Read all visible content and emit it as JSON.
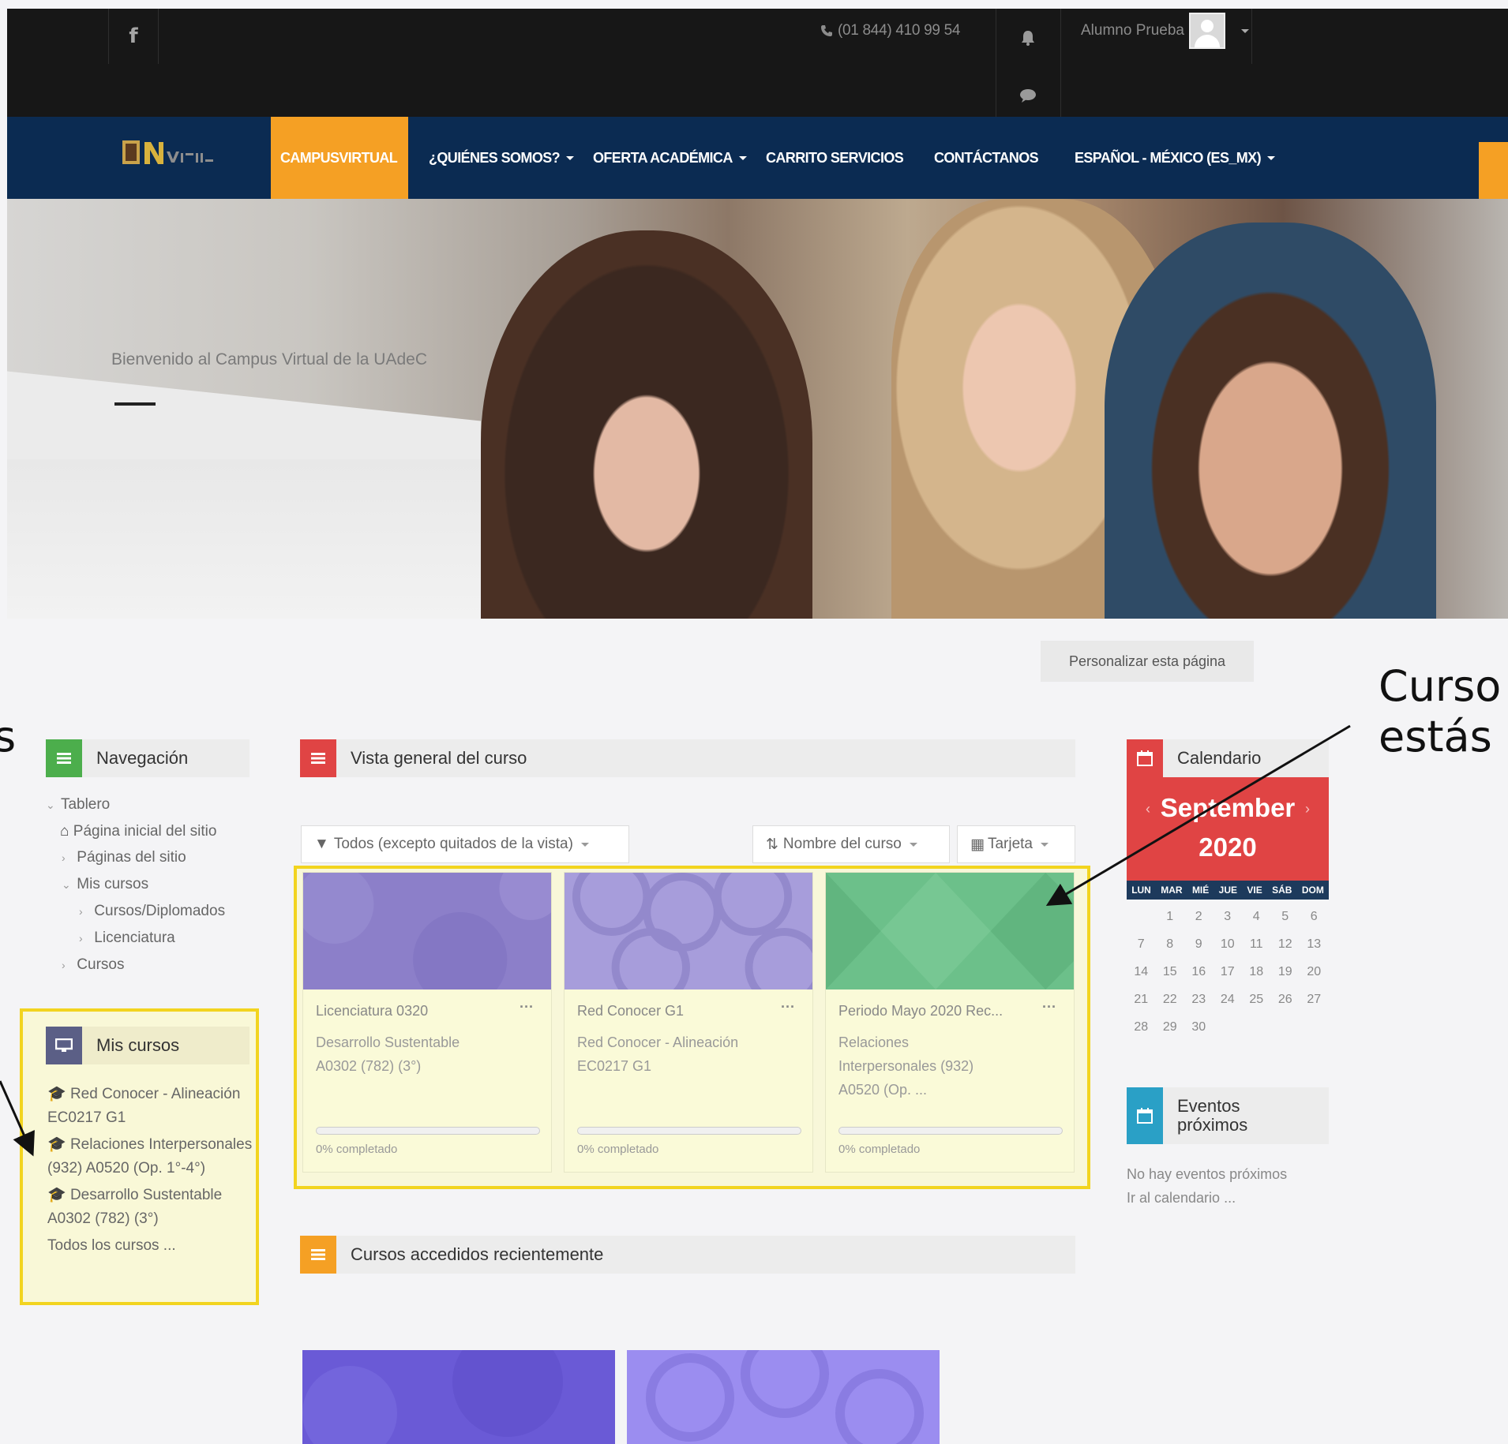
{
  "topbar": {
    "facebook_icon": "f",
    "phone": "(01 844) 410 99 54",
    "user_name": "Alumno Prueba"
  },
  "nav": {
    "items": [
      {
        "label": "CAMPUSVIRTUAL"
      },
      {
        "label": "¿QUIÉNES SOMOS?"
      },
      {
        "label": "OFERTA ACADÉMICA"
      },
      {
        "label": "CARRITO SERVICIOS"
      },
      {
        "label": "CONTÁCTANOS"
      },
      {
        "label": "ESPAÑOL - MÉXICO (ES_MX)"
      }
    ]
  },
  "hero": {
    "welcome": "Bienvenido al Campus Virtual de la UAdeC"
  },
  "personalize_label": "Personalizar esta página",
  "navegacion": {
    "title": "Navegación",
    "items": [
      "Tablero",
      "Página inicial del sitio",
      "Páginas del sitio",
      "Mis cursos",
      "Cursos/Diplomados",
      "Licenciatura",
      "Cursos"
    ]
  },
  "mis_cursos": {
    "title": "Mis cursos",
    "items": [
      {
        "text": "Red Conocer - Alineación EC0217 G1"
      },
      {
        "text": "Relaciones Interpersonales (932) A0520 (Op. 1°-4°)"
      },
      {
        "text": "Desarrollo Sustentable A0302 (782) (3°)"
      }
    ],
    "all": "Todos los cursos ..."
  },
  "overview": {
    "title": "Vista general del curso",
    "filter": "Todos (excepto quitados de la vista)",
    "sort": "Nombre del curso",
    "view": "Tarjeta",
    "cards": [
      {
        "category": "Licenciatura 0320",
        "name_1": "Desarrollo Sustentable",
        "name_2": "A0302 (782) (3°)",
        "name_3": "",
        "progress": "0% completado",
        "color": "#8c7fc9"
      },
      {
        "category": "Red Conocer G1",
        "name_1": "Red Conocer - Alineación",
        "name_2": "EC0217 G1",
        "name_3": "",
        "progress": "0% completado",
        "color": "#a79ddb"
      },
      {
        "category": "Periodo Mayo 2020 Rec...",
        "name_1": "Relaciones",
        "name_2": "Interpersonales (932)",
        "name_3": "A0520 (Op. ...",
        "progress": "0% completado",
        "color": "#6cc08a"
      }
    ]
  },
  "recent": {
    "title": "Cursos accedidos recientemente"
  },
  "calendar": {
    "title": "Calendario",
    "month": "September",
    "year": "2020",
    "dow": [
      "LUN",
      "MAR",
      "MIÉ",
      "JUE",
      "VIE",
      "SÁB",
      "DOM"
    ],
    "weeks": [
      [
        "",
        "1",
        "2",
        "3",
        "4",
        "5",
        "6"
      ],
      [
        "7",
        "8",
        "9",
        "10",
        "11",
        "12",
        "13"
      ],
      [
        "14",
        "15",
        "16",
        "17",
        "18",
        "19",
        "20"
      ],
      [
        "21",
        "22",
        "23",
        "24",
        "25",
        "26",
        "27"
      ],
      [
        "28",
        "29",
        "30",
        "",
        "",
        "",
        ""
      ]
    ]
  },
  "events": {
    "title_1": "Eventos",
    "title_2": "próximos",
    "none": "No hay eventos próximos",
    "go": "Ir al calendario ..."
  },
  "annotations": {
    "right_line1": "Curso",
    "right_line2": "estás",
    "left_fragment": "s"
  },
  "colors": {
    "topbar": "#171717",
    "navbar": "#0b2b52",
    "accent_orange": "#f5a024",
    "highlight_yellow": "#f2d41f",
    "calendar_red": "#e04444"
  }
}
